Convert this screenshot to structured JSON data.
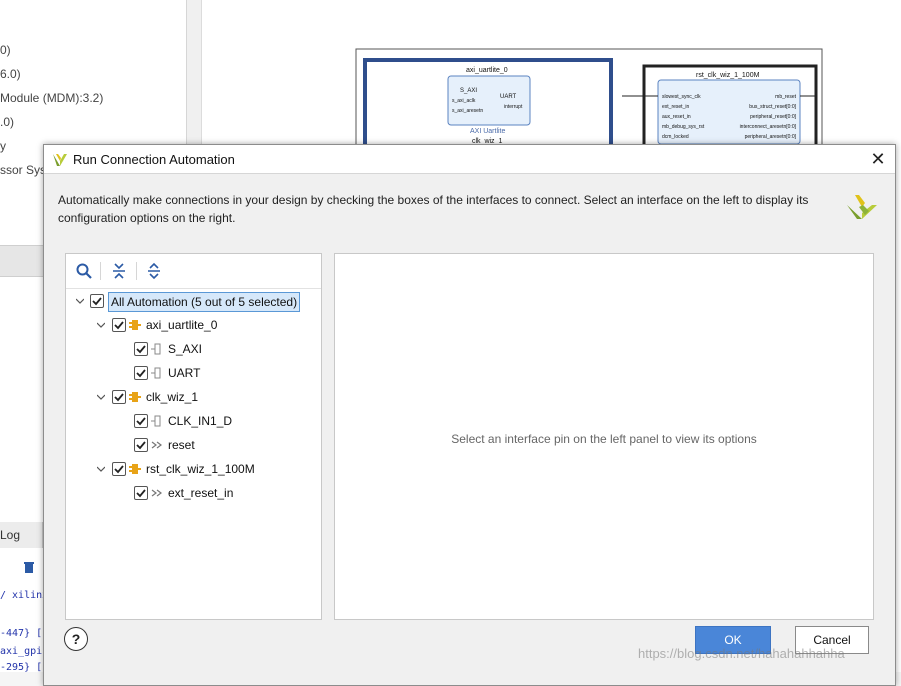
{
  "background": {
    "ip_list": [
      "0)",
      "6.0)",
      "Module (MDM):3.2)",
      ".0)",
      "y",
      "ssor Sys"
    ],
    "log_tab": "Log",
    "code_lines": [
      "/ xilinx",
      "-447} [",
      "axi_gpi",
      "-295} ["
    ],
    "diagram": {
      "uartlite": {
        "instance": "axi_uartlite_0",
        "type": "AXI Uartlite",
        "ports_left": [
          "S_AXI",
          "s_axi_aclk",
          "s_axi_aresetn"
        ],
        "ports_right": [
          "UART",
          "interrupt"
        ]
      },
      "clkwiz_label": "clk_wiz_1",
      "reset": {
        "instance": "rst_clk_wiz_1_100M",
        "ports_left": [
          "slowest_sync_clk",
          "ext_reset_in",
          "aux_reset_in",
          "mb_debug_sys_rst",
          "dcm_locked"
        ],
        "ports_right": [
          "mb_reset",
          "bus_struct_reset[0:0]",
          "peripheral_reset[0:0]",
          "interconnect_aresetn[0:0]",
          "peripheral_aresetn[0:0]"
        ]
      }
    }
  },
  "dialog": {
    "title": "Run Connection Automation",
    "description": "Automatically make connections in your design by checking the boxes of the interfaces to connect. Select an interface on the left to display its configuration options on the right.",
    "tree": {
      "root": {
        "label": "All Automation (5 out of 5 selected)",
        "checked": true
      },
      "groups": [
        {
          "label": "axi_uartlite_0",
          "checked": true,
          "items": [
            {
              "label": "S_AXI",
              "icon": "interface-pin-icon",
              "checked": true
            },
            {
              "label": "UART",
              "icon": "interface-pin-icon",
              "checked": true
            }
          ]
        },
        {
          "label": "clk_wiz_1",
          "checked": true,
          "items": [
            {
              "label": "CLK_IN1_D",
              "icon": "interface-pin-icon",
              "checked": true
            },
            {
              "label": "reset",
              "icon": "signal-pin-icon",
              "checked": true
            }
          ]
        },
        {
          "label": "rst_clk_wiz_1_100M",
          "checked": true,
          "items": [
            {
              "label": "ext_reset_in",
              "icon": "signal-pin-icon",
              "checked": true
            }
          ]
        }
      ]
    },
    "options_hint": "Select an interface pin on the left panel to view its options",
    "help_label": "?",
    "ok_label": "OK",
    "cancel_label": "Cancel"
  },
  "watermark": "https://blog.csdn.net/hahahahhahha",
  "colors": {
    "accent": "#4a86d8",
    "selection": "#d6e8fa",
    "ip_icon": "#e8a317"
  }
}
